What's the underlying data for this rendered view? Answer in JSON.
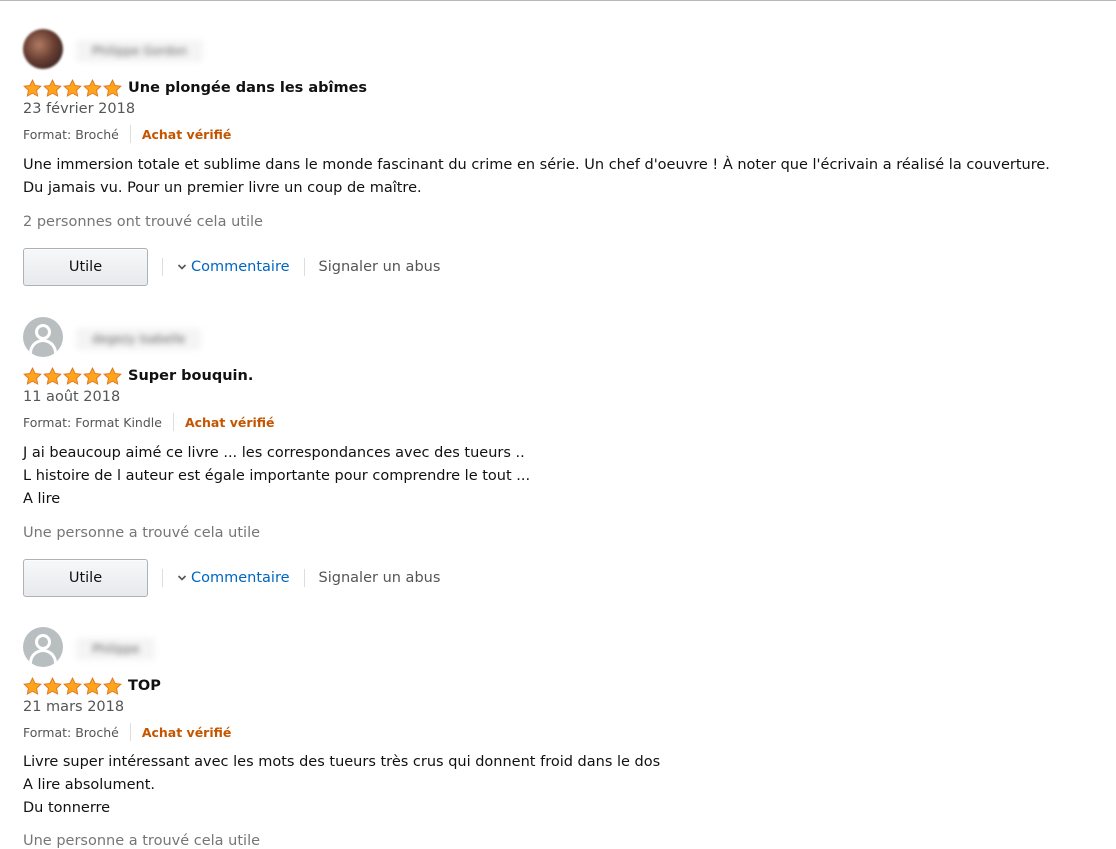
{
  "colors": {
    "star": "#ffa41c",
    "link": "#0066c0",
    "verified": "#c45500"
  },
  "reviews": [
    {
      "author": "Philippe Gordon",
      "avatar": "photo",
      "rating": 5,
      "title": "Une plongée dans les abîmes",
      "date": "23 février 2018",
      "format": "Format: Broché",
      "verified": "Achat vérifié",
      "body": [
        "Une immersion totale et sublime dans le monde fascinant du crime en série. Un chef d'oeuvre ! À noter que l'écrivain a réalisé la couverture.",
        "Du jamais vu. Pour un premier livre un coup de maître."
      ],
      "helpful": "2 personnes ont trouvé cela utile",
      "useful_button": "Utile",
      "comment_label": "Commentaire",
      "report_label": "Signaler un abus"
    },
    {
      "author": "degezy Isabelle",
      "avatar": "generic",
      "rating": 5,
      "title": "Super bouquin.",
      "date": "11 août 2018",
      "format": "Format: Format Kindle",
      "verified": "Achat vérifié",
      "body": [
        "J ai beaucoup aimé ce livre ... les correspondances avec des tueurs ..",
        "L histoire de l auteur est égale importante pour comprendre le tout ...",
        "A lire"
      ],
      "helpful": "Une personne a trouvé cela utile",
      "useful_button": "Utile",
      "comment_label": "Commentaire",
      "report_label": "Signaler un abus"
    },
    {
      "author": "Philippe",
      "avatar": "generic",
      "rating": 5,
      "title": "TOP",
      "date": "21 mars 2018",
      "format": "Format: Broché",
      "verified": "Achat vérifié",
      "body": [
        "Livre super intéressant avec les mots des tueurs très crus qui donnent froid dans le dos",
        "A lire absolument.",
        "Du tonnerre"
      ],
      "helpful": "Une personne a trouvé cela utile"
    }
  ]
}
